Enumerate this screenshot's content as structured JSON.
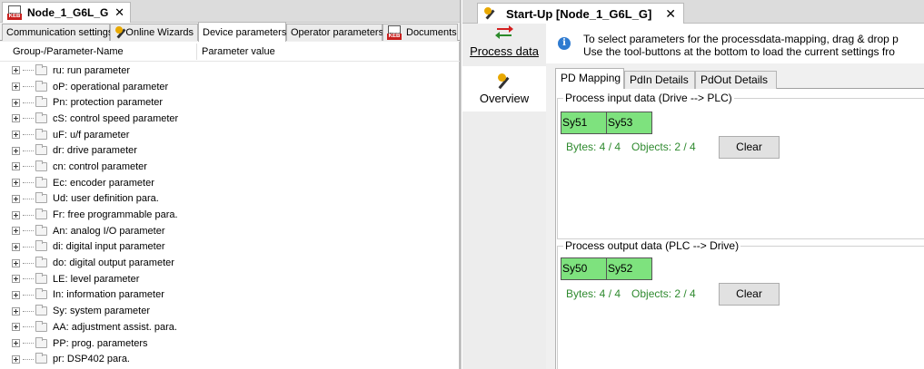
{
  "left": {
    "doc_tab": {
      "title": "Node_1_G6L_G",
      "close": "✕",
      "badge": "KEB"
    },
    "tabs": [
      {
        "label": "Communication settings"
      },
      {
        "label": "Online Wizards"
      },
      {
        "label": "Device parameters",
        "active": true
      },
      {
        "label": "Operator parameters"
      },
      {
        "label": "Documents"
      }
    ],
    "tree": {
      "col_name": "Group-/Parameter-Name",
      "col_value": "Parameter value",
      "items": [
        "ru: run parameter",
        "oP: operational parameter",
        "Pn: protection parameter",
        "cS: control speed parameter",
        "uF: u/f parameter",
        "dr: drive parameter",
        "cn: control parameter",
        "Ec: encoder parameter",
        "Ud: user definition para.",
        "Fr: free programmable para.",
        "An: analog I/O parameter",
        "di: digital input parameter",
        "do: digital output parameter",
        "LE: level parameter",
        "In: information parameter",
        "Sy: system parameter",
        "AA: adjustment assist. para.",
        "PP: prog. parameters",
        "pr: DSP402 para."
      ]
    }
  },
  "right": {
    "doc_tab": {
      "title": "Start-Up [Node_1_G6L_G]",
      "close": "✕"
    },
    "nav": {
      "process_data": "Process data",
      "overview": "Overview"
    },
    "info": {
      "line1": "To select parameters for the processdata-mapping, drag & drop p",
      "line2": "Use the tool-buttons at the bottom to load the current settings fro"
    },
    "tabs": [
      {
        "label": "PD Mapping",
        "active": true
      },
      {
        "label": "PdIn Details"
      },
      {
        "label": "PdOut Details"
      }
    ],
    "input_group": {
      "title": "Process input data (Drive  --> PLC)",
      "slots": [
        "Sy51",
        "Sy53"
      ],
      "bytes": "Bytes: 4 / 4",
      "objects": "Objects: 2 / 4",
      "clear": "Clear"
    },
    "output_group": {
      "title": "Process output data (PLC --> Drive)",
      "slots": [
        "Sy50",
        "Sy52"
      ],
      "bytes": "Bytes: 4 / 4",
      "objects": "Objects: 2 / 4",
      "clear": "Clear"
    },
    "colors": {
      "slot_fill": "#7ee27e",
      "stats_text": "#2f8a2f",
      "info_icon": "#2f7bd0"
    }
  }
}
